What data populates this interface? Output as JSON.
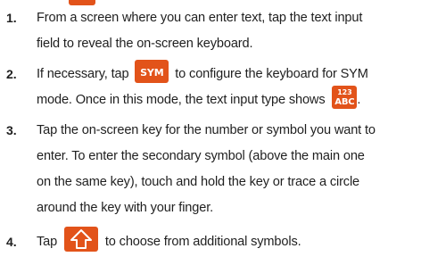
{
  "accent_color": "#e2531a",
  "steps": [
    {
      "number": "1.",
      "lines": [
        "From a screen where you can enter text, tap the text input",
        "field to reveal the on-screen keyboard."
      ]
    },
    {
      "number": "2.",
      "line1_before": "If necessary, tap",
      "key_sym": "SYM",
      "line1_after": "to configure the keyboard for SYM",
      "line2_before": "mode. Once in this mode, the text input type shows",
      "key_abc_top": "123",
      "key_abc_bottom": "ABC",
      "line2_after": "."
    },
    {
      "number": "3.",
      "lines": [
        "Tap the on-screen key for the number or symbol you want to",
        "enter. To enter the secondary symbol (above the main one",
        "on the same key), touch and hold the key or trace a circle",
        "around the key with your finger."
      ]
    },
    {
      "number": "4.",
      "before": "Tap",
      "key_icon": "shift-up-arrow-icon",
      "after": "to choose from additional symbols."
    }
  ]
}
